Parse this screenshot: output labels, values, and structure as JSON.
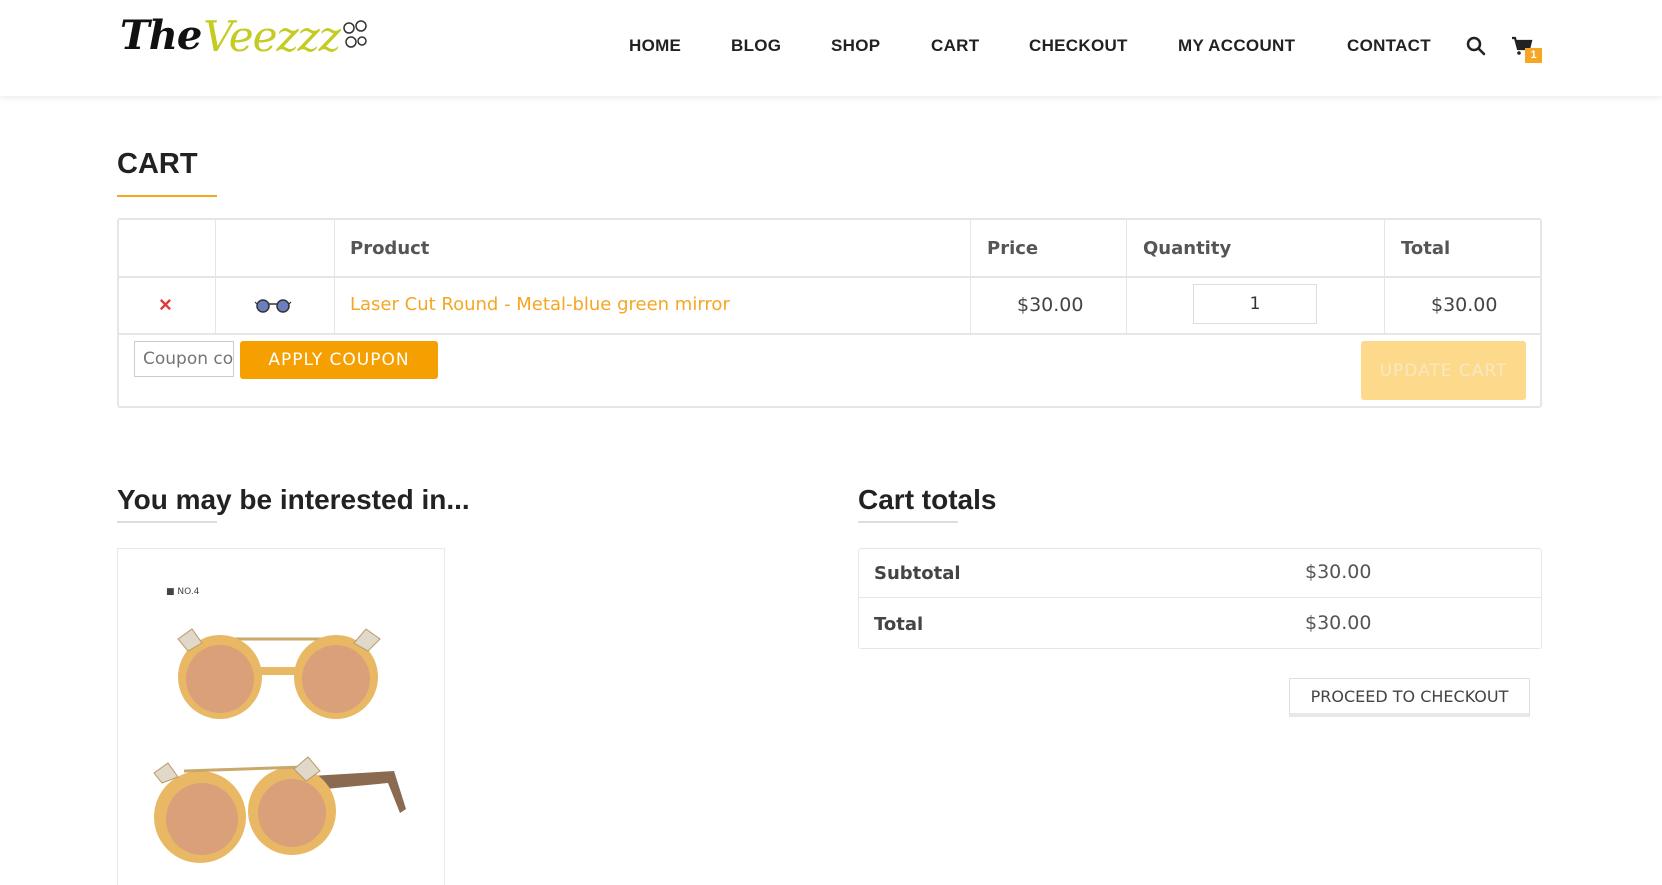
{
  "brand": {
    "logo_prefix": "The",
    "logo_name": "Veezzz"
  },
  "nav": {
    "items": [
      "HOME",
      "BLOG",
      "SHOP",
      "CART",
      "CHECKOUT",
      "MY ACCOUNT",
      "CONTACT"
    ],
    "cart_count": "1"
  },
  "page": {
    "title": "CART"
  },
  "cart_table": {
    "headers": {
      "product": "Product",
      "price": "Price",
      "quantity": "Quantity",
      "total": "Total"
    },
    "rows": [
      {
        "remove": "×",
        "product": "Laser Cut Round - Metal-blue green mirror",
        "price": "$30.00",
        "quantity": "1",
        "total": "$30.00"
      }
    ],
    "coupon_placeholder": "Coupon code",
    "apply_label": "APPLY COUPON",
    "update_label": "UPDATE CART"
  },
  "interested": {
    "title": "You may be interested in...",
    "tag": "■ NO.4"
  },
  "totals": {
    "title": "Cart totals",
    "subtotal_label": "Subtotal",
    "subtotal_value": "$30.00",
    "total_label": "Total",
    "total_value": "$30.00",
    "checkout_label": "PROCEED TO CHECKOUT"
  },
  "colors": {
    "accent": "#f5a623",
    "remove": "#e03a3a",
    "logo_green": "#c4cc22"
  }
}
